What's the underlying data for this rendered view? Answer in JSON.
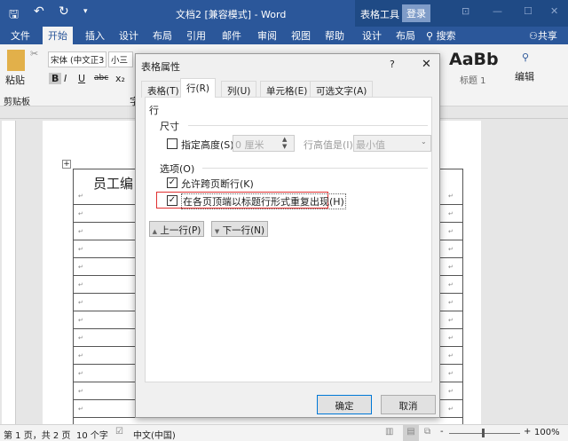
{
  "title": {
    "doc": "文档2 [兼容模式]  -  Word",
    "tools": "表格工具",
    "login": "登录"
  },
  "tabs": [
    "文件",
    "开始",
    "插入",
    "设计",
    "布局",
    "引用",
    "邮件",
    "审阅",
    "视图",
    "帮助",
    "设计",
    "布局"
  ],
  "search": "搜索",
  "share": "共享",
  "ribbon": {
    "paste": "粘贴",
    "clipboard": "剪贴板",
    "font": "宋体 (中文正3",
    "size": "小三",
    "bold": "B",
    "italic": "I",
    "underline": "U",
    "strike": "abc",
    "sub": "x₂",
    "style_preview": "AaBb",
    "style_name": "标题 1",
    "edit": "编辑",
    "font_group": "字"
  },
  "document": {
    "cell_title": "员工编",
    "para_mark": "↵"
  },
  "dialog": {
    "title": "表格属性",
    "help": "?",
    "close": "✕",
    "tabs": [
      "表格(T)",
      "行(R)",
      "列(U)",
      "单元格(E)",
      "可选文字(A)"
    ],
    "section_row": "行",
    "size": "尺寸",
    "specify_height": "指定高度(S):",
    "height_value": "0 厘米",
    "height_is": "行高值是(I):",
    "height_mode": "最小值",
    "options": "选项(O)",
    "allow_break": "允许跨页断行(K)",
    "repeat_header": "在各页顶端以标题行形式重复出现(H)",
    "prev_row": "上一行(P)",
    "next_row": "下一行(N)",
    "ok": "确定",
    "cancel": "取消",
    "specify_checked": false,
    "allow_checked": true,
    "repeat_checked": true
  },
  "status": {
    "page": "第 1 页，共 2 页",
    "words": "10 个字",
    "lang": "中文(中国)",
    "zoom": "100%"
  }
}
